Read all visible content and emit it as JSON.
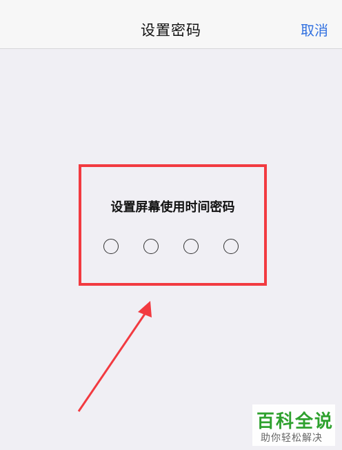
{
  "navbar": {
    "title": "设置密码",
    "cancel_label": "取消"
  },
  "passcode": {
    "title": "设置屏幕使用时间密码",
    "digits": 4
  },
  "highlight_color": "#f23a40",
  "watermark": {
    "main": "百科全说",
    "sub": "助你轻松解决"
  }
}
